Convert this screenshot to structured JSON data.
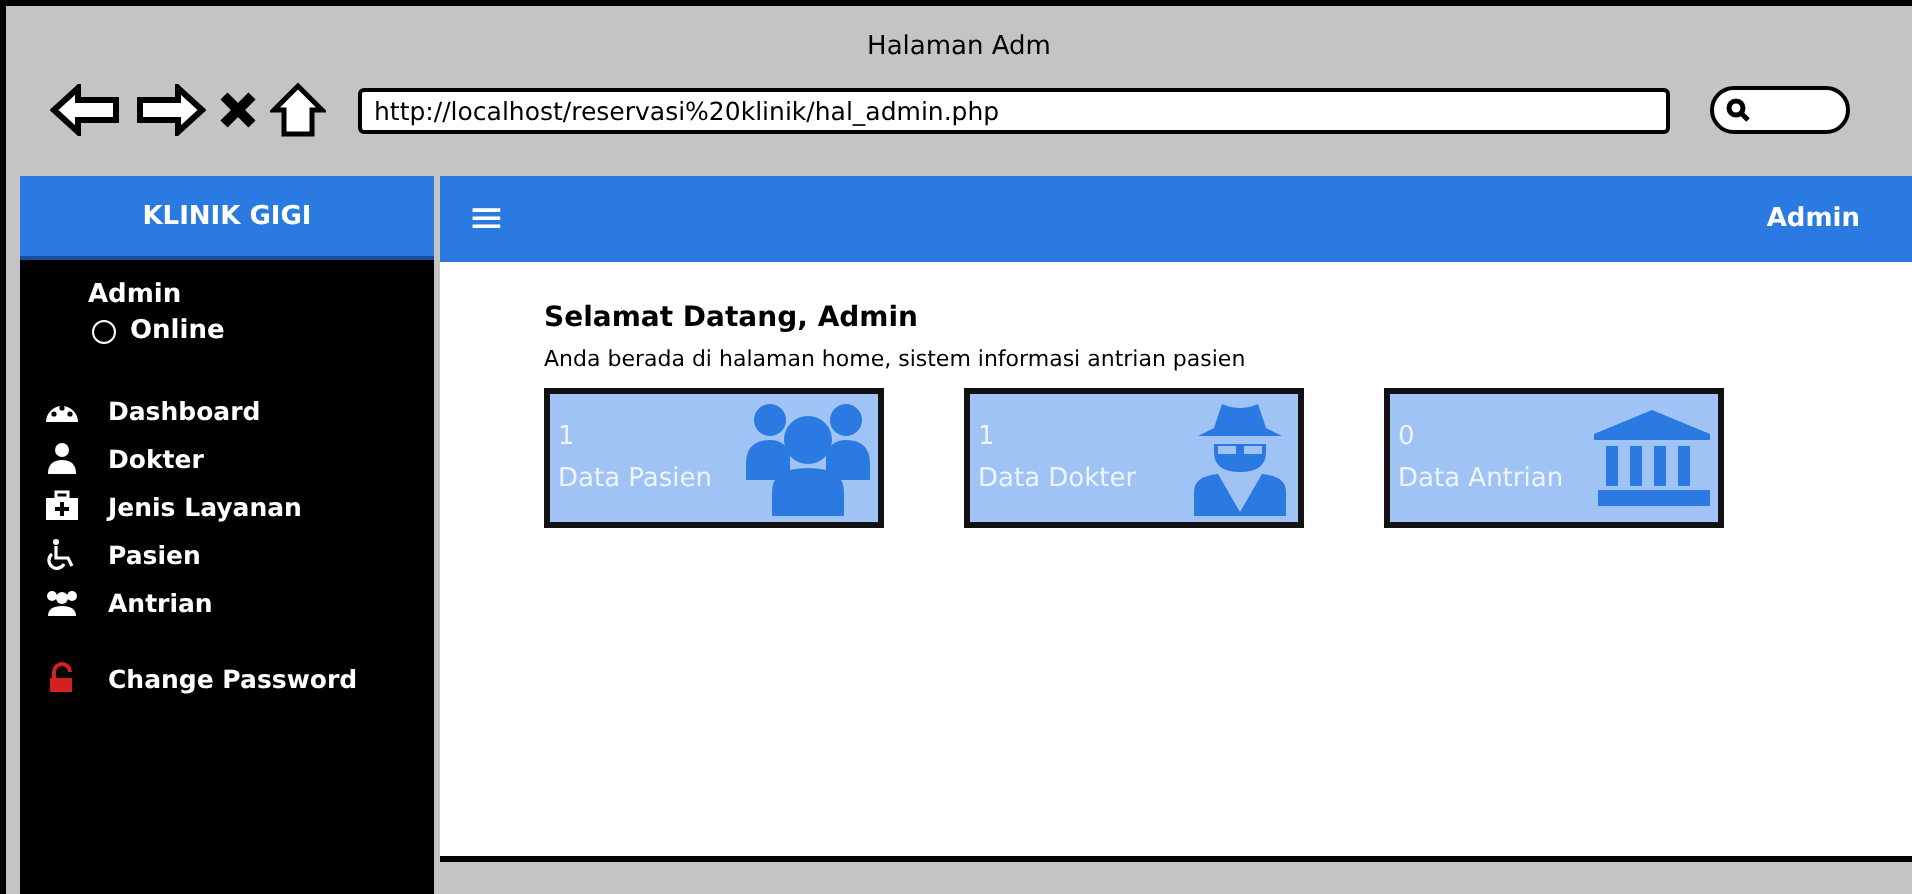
{
  "window": {
    "title": "Halaman Adm",
    "url": "http://localhost/reservasi%20klinik/hal_admin.php"
  },
  "sidebar": {
    "brand": "KLINIK GIGI",
    "user": "Admin",
    "status": "Online",
    "items": [
      {
        "label": "Dashboard",
        "kind": "gauge"
      },
      {
        "label": "Dokter",
        "kind": "doctor"
      },
      {
        "label": "Jenis Layanan",
        "kind": "medkit"
      },
      {
        "label": "Pasien",
        "kind": "wheelchair"
      },
      {
        "label": "Antrian",
        "kind": "users"
      },
      {
        "label": "Change Password",
        "kind": "lock"
      }
    ]
  },
  "topbar": {
    "menu_glyph": "≡",
    "user": "Admin"
  },
  "content": {
    "heading": "Selamat Datang, Admin",
    "subtitle": "Anda berada di halaman home, sistem informasi antrian pasien",
    "cards": [
      {
        "count": "1",
        "label": "Data Pasien",
        "kind": "users"
      },
      {
        "count": "1",
        "label": "Data Dokter",
        "kind": "spy"
      },
      {
        "count": "0",
        "label": "Data Antrian",
        "kind": "bank"
      }
    ]
  }
}
